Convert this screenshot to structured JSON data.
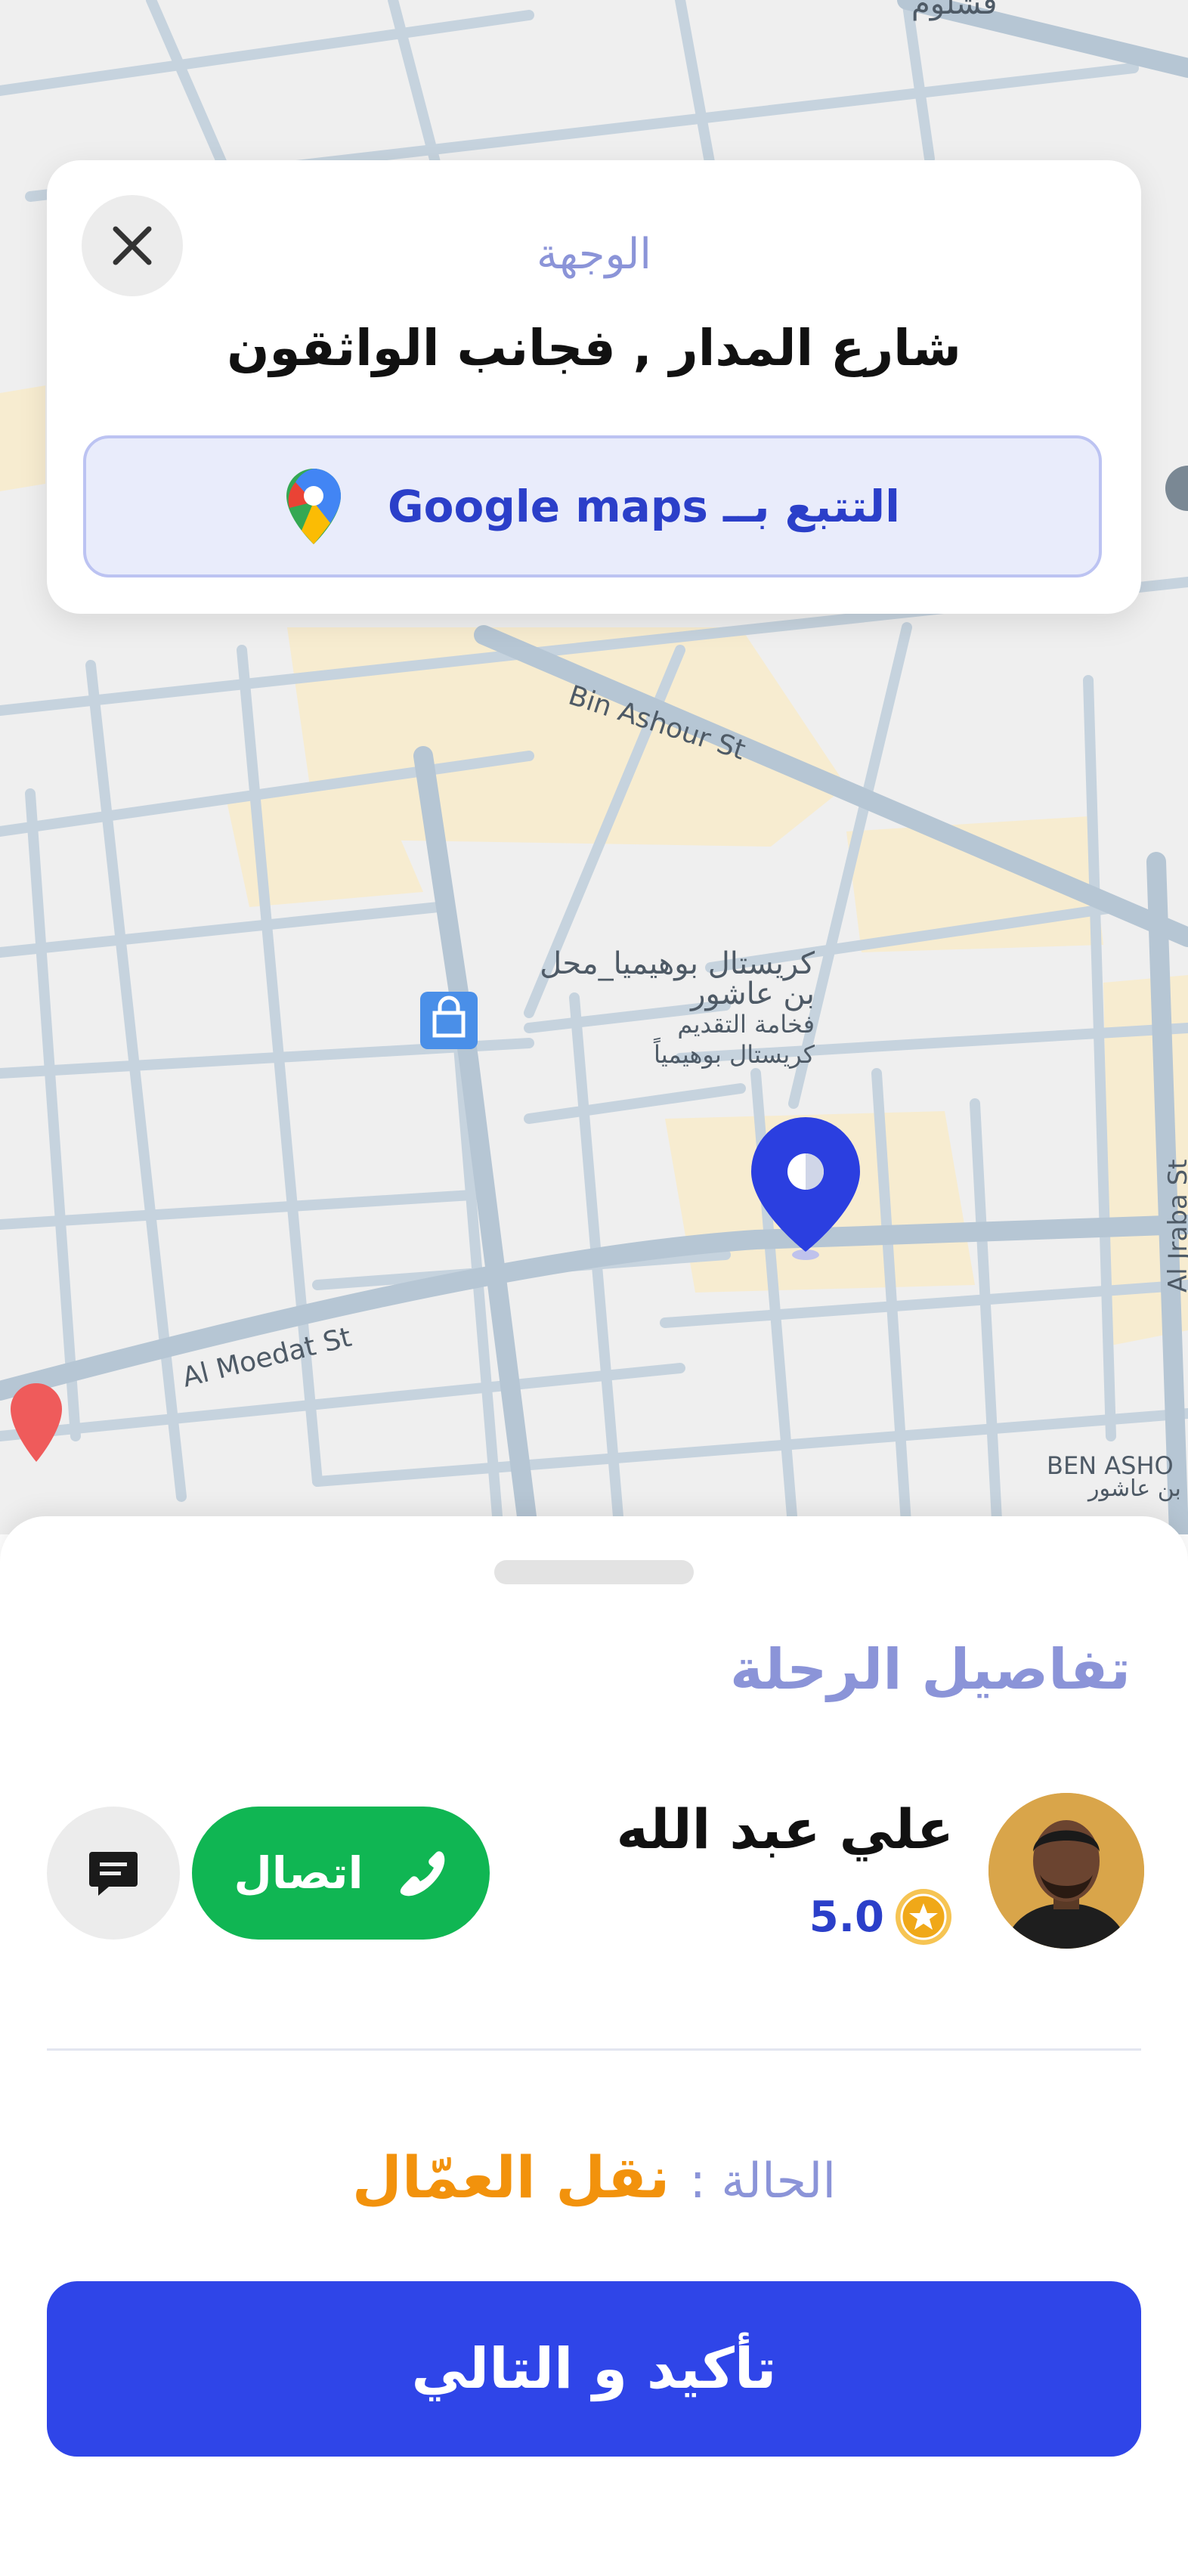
{
  "map": {
    "street_labels": [
      "Bin Ashour St",
      "Al Moedat St",
      "Al Jraba St",
      "BEN ASHO"
    ],
    "poi_label_lines": [
      "كريستال بوهيميا_محل",
      "بن عاشور",
      "فخامة التقديم",
      "كريستال بوهيمياً"
    ],
    "top_label": "قشلوم",
    "corner_label": "بن عاشور",
    "pin_color": "#2b3fe0"
  },
  "destination": {
    "label": "الوجهة",
    "address": "شارع المدار , فجانب الواثقون",
    "track_button": "التتبع بــ Google maps"
  },
  "trip": {
    "title": "تفاصيل الرحلة",
    "driver_name": "علي عبد الله",
    "rating": "5.0",
    "call_label": "اتصال",
    "status_label": "الحالة :",
    "status_value": "نقل العمّال",
    "confirm_label": "تأكيد و التالي"
  },
  "colors": {
    "primary": "#2f45e8",
    "call_green": "#10b653",
    "status_orange": "#f2920c",
    "muted_purple": "#8b94d8"
  }
}
